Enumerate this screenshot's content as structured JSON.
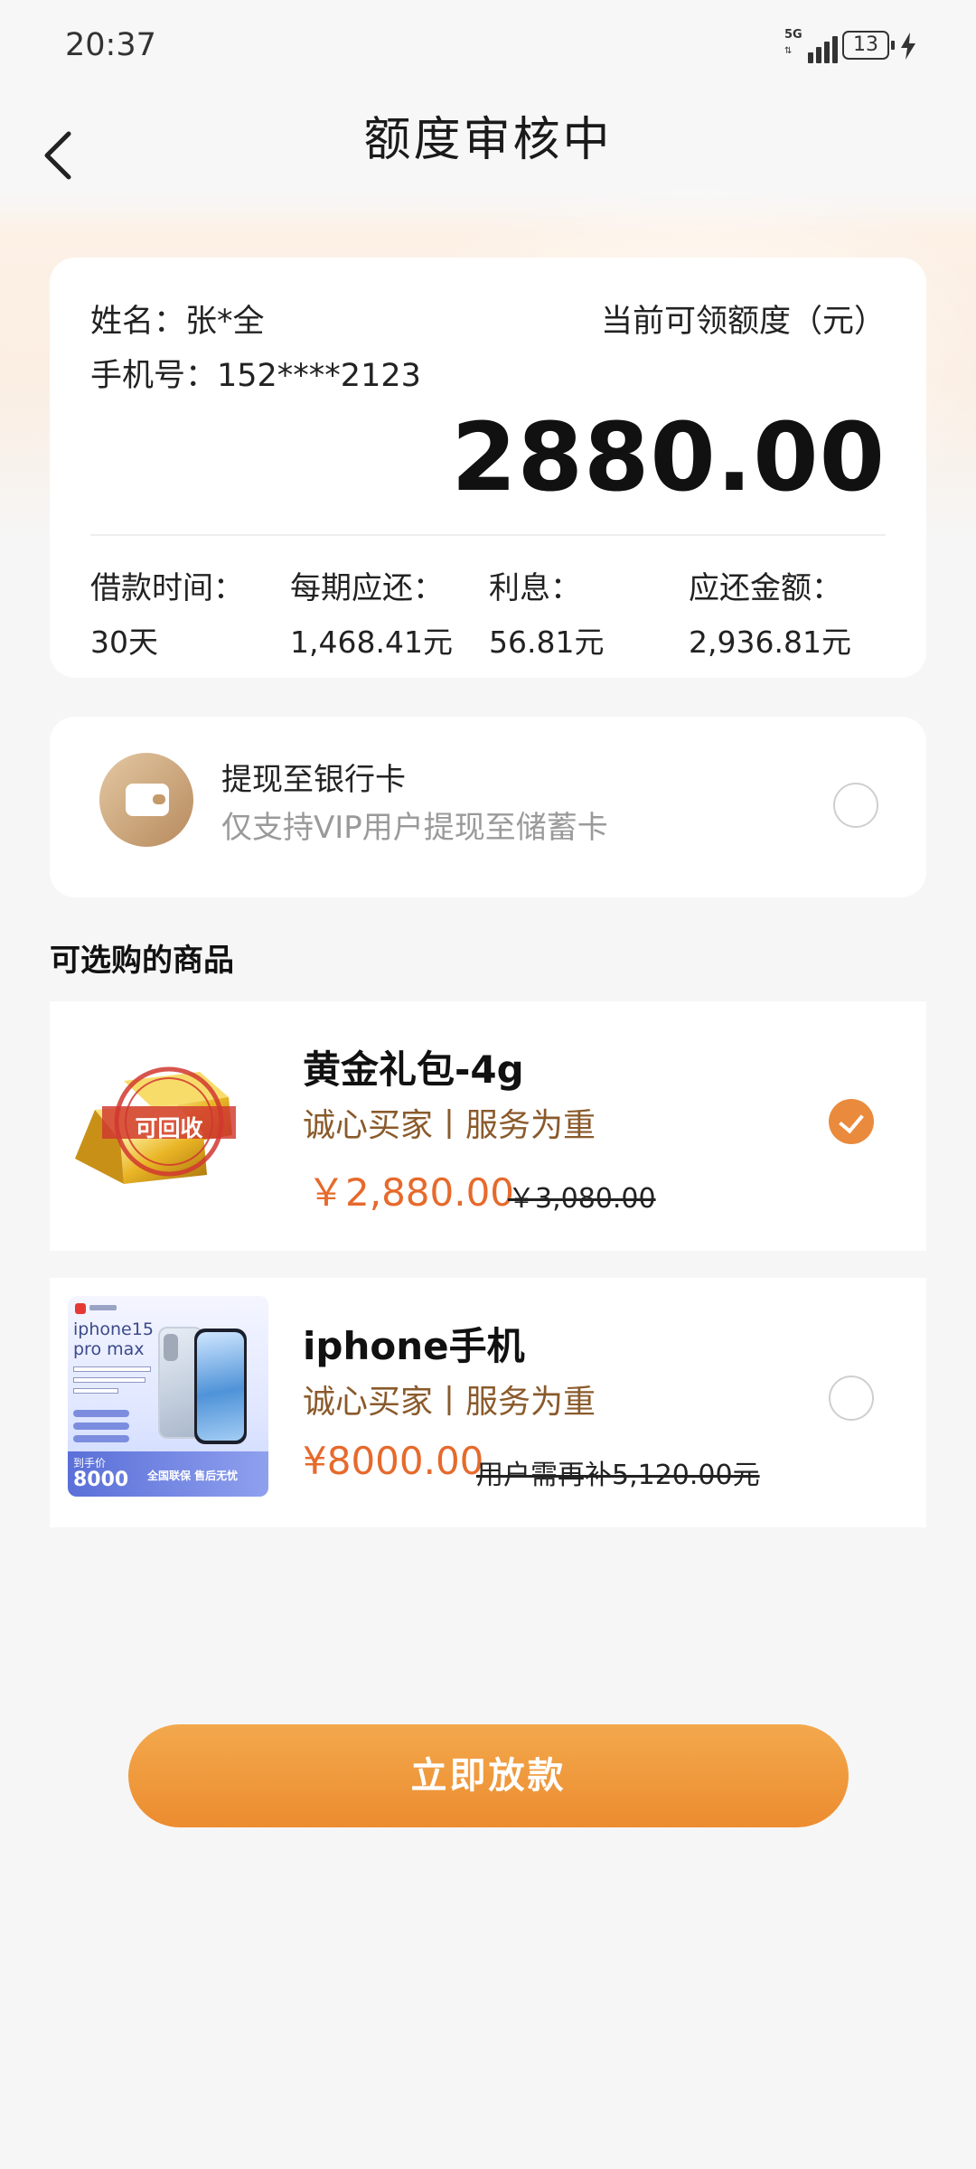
{
  "status_bar": {
    "time": "20:37",
    "network": "5G",
    "battery": "13"
  },
  "header": {
    "title": "额度审核中"
  },
  "quota_card": {
    "name_label": "姓名：张*全",
    "phone_label": "手机号：152****2123",
    "quota_title": "当前可领额度（元）",
    "quota_amount": "2880.00",
    "stats": [
      {
        "key": "借款时间：",
        "value": "30天"
      },
      {
        "key": "每期应还：",
        "value": "1,468.41元"
      },
      {
        "key": "利息：",
        "value": "56.81元"
      },
      {
        "key": "应还金额：",
        "value": "2,936.81元"
      }
    ]
  },
  "withdraw": {
    "title": "提现至银行卡",
    "subtitle": "仅支持VIP用户提现至储蓄卡",
    "selected": false
  },
  "products_section": {
    "title": "可选购的商品"
  },
  "products": [
    {
      "name": "黄金礼包-4g",
      "slogan": "诚心买家丨服务为重",
      "price": "￥2,880.00",
      "old_price": "￥3,080.00",
      "stamp": "可回收",
      "selected": true
    },
    {
      "name": "iphone手机",
      "slogan": "诚心买家丨服务为重",
      "price": "¥8000.00",
      "old_price": "用户需再补5,120.00元",
      "thumb_text": {
        "line1": "iphone15",
        "line2": "pro max",
        "price_tag": "8000",
        "service": "全国联保 售后无忧"
      },
      "selected": false
    }
  ],
  "cta": {
    "label": "立即放款"
  },
  "colors": {
    "accent": "#ea8a3c",
    "price": "#e66a2c",
    "slogan": "#8a5a2b"
  }
}
